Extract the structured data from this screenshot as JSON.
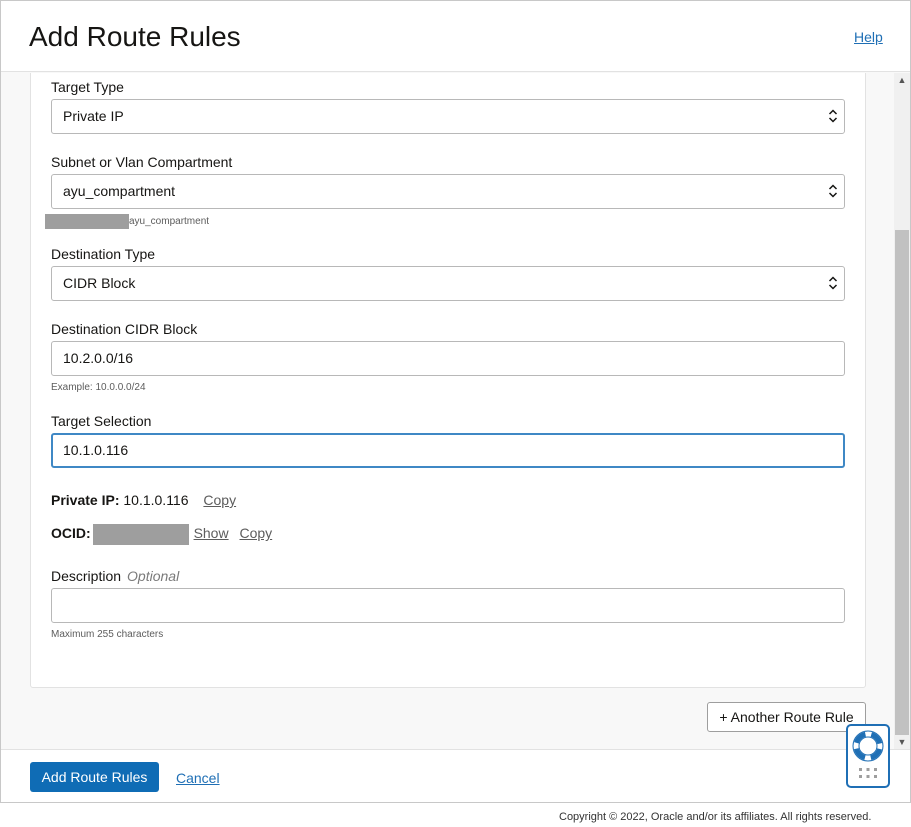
{
  "header": {
    "title": "Add Route Rules",
    "help_label": "Help"
  },
  "form": {
    "target_type": {
      "label": "Target Type",
      "value": "Private IP"
    },
    "compartment": {
      "label": "Subnet or Vlan Compartment",
      "value": "ayu_compartment",
      "hint": "ayu_compartment"
    },
    "destination_type": {
      "label": "Destination Type",
      "value": "CIDR Block"
    },
    "destination_cidr": {
      "label": "Destination CIDR Block",
      "value": "10.2.0.0/16",
      "hint": "Example: 10.0.0.0/24"
    },
    "target_selection": {
      "label": "Target Selection",
      "value": "10.1.0.116"
    },
    "private_ip": {
      "label": "Private IP:",
      "value": "10.1.0.116",
      "copy_label": "Copy"
    },
    "ocid": {
      "label": "OCID:",
      "show_label": "Show",
      "copy_label": "Copy"
    },
    "description": {
      "label": "Description",
      "optional": "Optional",
      "value": "",
      "hint": "Maximum 255 characters"
    }
  },
  "another_rule_label": "+ Another Route Rule",
  "footer": {
    "primary_label": "Add Route Rules",
    "cancel_label": "Cancel"
  },
  "copyright": "Copyright © 2022, Oracle and/or its affiliates. All rights reserved.",
  "colors": {
    "primary": "#0f6cb5",
    "link": "#1f6fb5",
    "focus": "#3f88c5"
  },
  "icons": [
    "chevron-updown-icon",
    "lifebuoy-icon",
    "grid-dots-icon",
    "scroll-up-icon",
    "scroll-down-icon"
  ]
}
